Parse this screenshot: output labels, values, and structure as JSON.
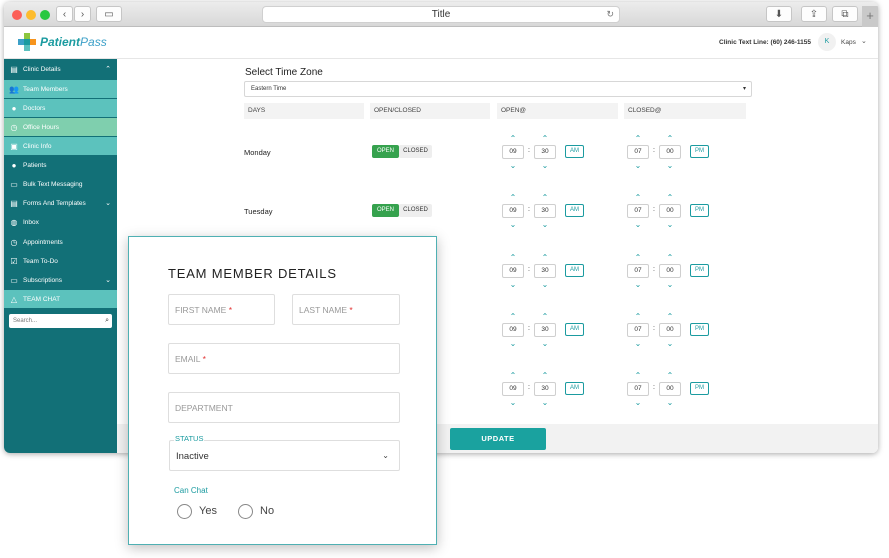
{
  "browser": {
    "url_title": "Title"
  },
  "header": {
    "logo_main": "Patient",
    "logo_accent": "Pass",
    "clinic_text_line": "Clinic Text Line: (60) 246-1155",
    "avatar_initial": "K",
    "username": "Kaps"
  },
  "sidebar": {
    "items": [
      {
        "label": "Clinic Details"
      },
      {
        "label": "Team Members"
      },
      {
        "label": "Doctors"
      },
      {
        "label": "Office Hours"
      },
      {
        "label": "Clinic Info"
      },
      {
        "label": "Patients"
      },
      {
        "label": "Bulk Text Messaging"
      },
      {
        "label": "Forms And Templates"
      },
      {
        "label": "Inbox"
      },
      {
        "label": "Appointments"
      },
      {
        "label": "Team To-Do"
      },
      {
        "label": "Subscriptions"
      },
      {
        "label": "TEAM CHAT"
      }
    ],
    "search_placeholder": "Search..."
  },
  "hours": {
    "title": "Select Time Zone",
    "timezone": "Eastern Time",
    "columns": [
      "DAYS",
      "OPEN/CLOSED",
      "OPEN@",
      "CLOSED@"
    ],
    "toggle_open": "OPEN",
    "toggle_closed": "CLOSED",
    "rows": [
      {
        "day": "Monday",
        "open_h": "09",
        "open_m": "30",
        "open_p": "AM",
        "close_h": "07",
        "close_m": "00",
        "close_p": "PM"
      },
      {
        "day": "Tuesday",
        "open_h": "09",
        "open_m": "30",
        "open_p": "AM",
        "close_h": "07",
        "close_m": "00",
        "close_p": "PM"
      },
      {
        "day": "",
        "open_h": "09",
        "open_m": "30",
        "open_p": "AM",
        "close_h": "07",
        "close_m": "00",
        "close_p": "PM"
      },
      {
        "day": "",
        "open_h": "09",
        "open_m": "30",
        "open_p": "AM",
        "close_h": "07",
        "close_m": "00",
        "close_p": "PM"
      },
      {
        "day": "",
        "open_h": "09",
        "open_m": "30",
        "open_p": "AM",
        "close_h": "07",
        "close_m": "00",
        "close_p": "PM"
      }
    ],
    "update_label": "UPDATE"
  },
  "modal": {
    "title": "TEAM MEMBER DETAILS",
    "first_name": "FIRST NAME",
    "last_name": "LAST NAME",
    "email": "EMAIL",
    "department": "DEPARTMENT",
    "required_mark": "*",
    "status_label": "STATUS",
    "status_value": "Inactive",
    "can_chat_label": "Can Chat",
    "yes": "Yes",
    "no": "No"
  },
  "colors": {
    "teal": "#127077",
    "accent": "#1b9ba0",
    "open_green": "#36a24e"
  }
}
